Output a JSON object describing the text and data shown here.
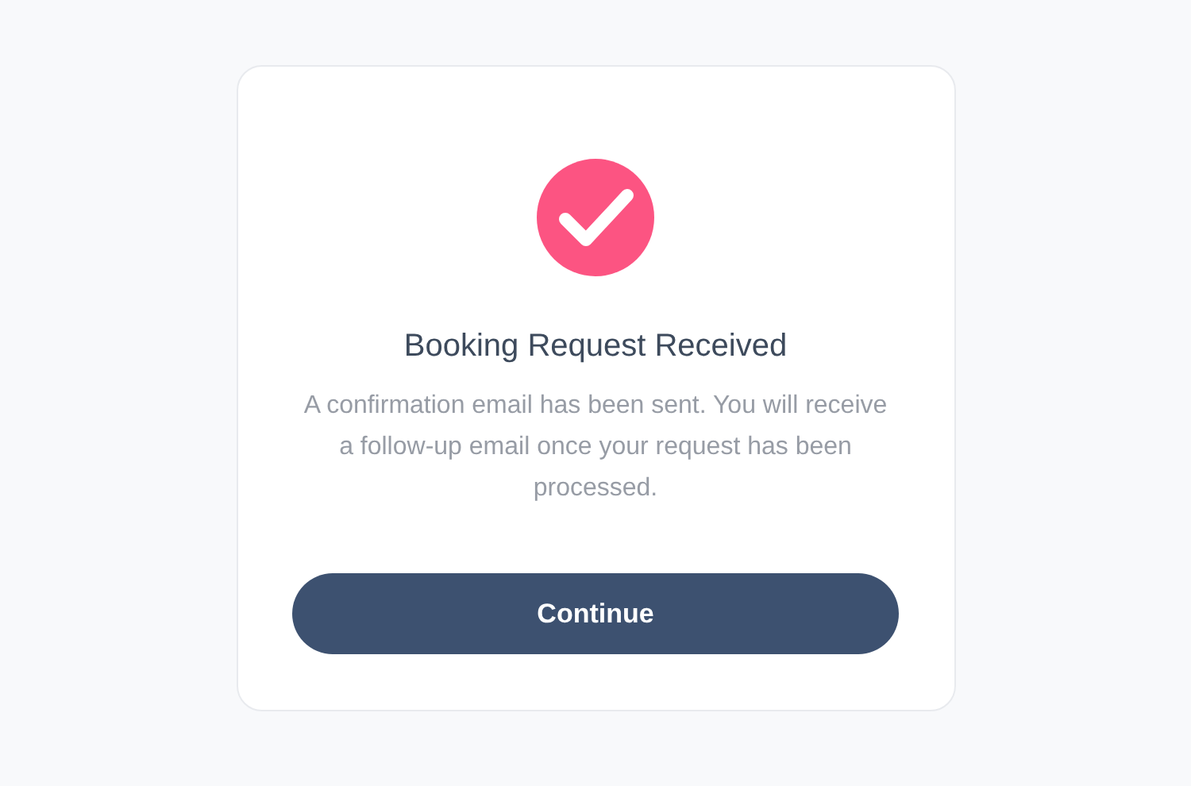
{
  "dialog": {
    "title": "Booking Request Received",
    "message": "A confirmation email has been sent. You will receive a follow-up email once your request has been processed.",
    "button": "Continue"
  }
}
